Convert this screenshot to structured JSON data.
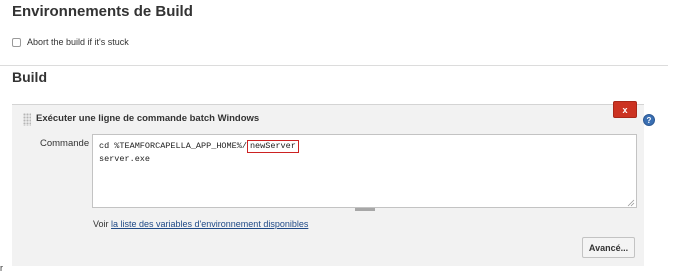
{
  "section_env": {
    "title": "Environnements de Build",
    "abort_label": "Abort the build if it's stuck",
    "abort_checked": false
  },
  "section_build": {
    "title": "Build"
  },
  "step": {
    "title": "Exécuter une ligne de commande batch Windows",
    "delete_label": "x",
    "help_label": "?",
    "command_label": "Commande",
    "command_line1_prefix": "cd %TEAMFORCAPELLA_APP_HOME%/",
    "command_line1_highlight": "newServer",
    "command_line2": "server.exe",
    "vars_prefix": "Voir ",
    "vars_link": "la liste des variables d'environnement disponibles",
    "advanced_label": "Avancé..."
  },
  "stray_text": "r",
  "colors": {
    "delete_button": "#cc3322",
    "highlight_border": "#cc2222",
    "link": "#204a87",
    "help_icon": "#3a6fb3"
  }
}
